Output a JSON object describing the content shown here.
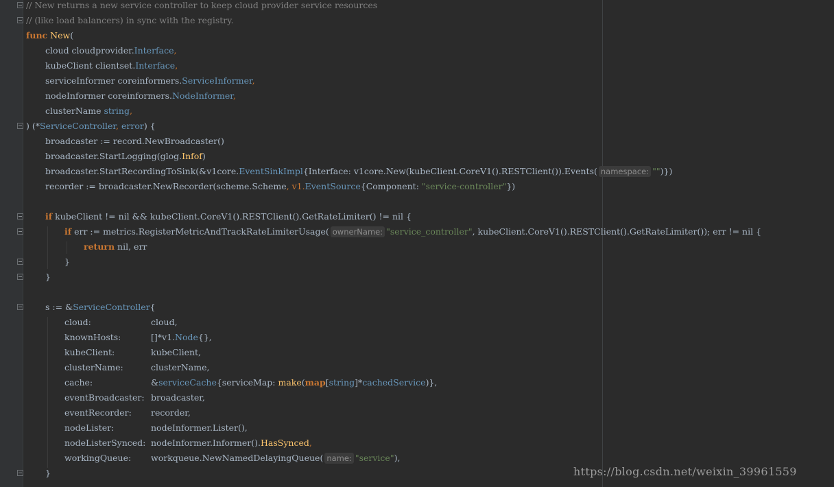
{
  "editor": {
    "theme": "darcula",
    "colors": {
      "background": "#2b2b2b",
      "keyword": "#cc7832",
      "function": "#ffc66d",
      "type": "#6897bb",
      "string": "#6a8759",
      "comment": "#808080",
      "text": "#a9b7c6"
    },
    "lines": {
      "l1": "// New returns a new service controller to keep cloud provider service resources",
      "l2": "// (like load balancers) in sync with the registry.",
      "l3_kw": "func",
      "l3_fn": "New",
      "l3_rest": "(",
      "l4_a": "cloud cloudprovider.",
      "l4_t": "Interface",
      "l5_a": "kubeClient clientset.",
      "l5_t": "Interface",
      "l6_a": "serviceInformer coreinformers.",
      "l6_t": "ServiceInformer",
      "l7_a": "nodeInformer coreinformers.",
      "l7_t": "NodeInformer",
      "l8_a": "clusterName ",
      "l8_t": "string",
      "l9_a": ") (*",
      "l9_t": "ServiceController",
      "l9_b": ", ",
      "l9_t2": "error",
      "l9_c": ") {",
      "l10": "broadcaster := record.NewBroadcaster()",
      "l11_a": "broadcaster.StartLogging(glog.",
      "l11_f": "Infof",
      "l11_b": ")",
      "l12_a": "broadcaster.StartRecordingToSink(&v1core.",
      "l12_t": "EventSinkImpl",
      "l12_b": "{Interface: v1core.New(kubeClient.CoreV1().RESTClient()).Events(",
      "l12_hint": "namespace:",
      "l12_s": "\"\"",
      "l12_c": ")})",
      "l13_a": "recorder := broadcaster.NewRecorder(scheme.Scheme",
      "l13_b": ", v1.",
      "l13_t": "EventSource",
      "l13_c": "{Component: ",
      "l13_s": "\"service-controller\"",
      "l13_d": "})",
      "l15_kw": "if",
      "l15_rest": " kubeClient != nil && kubeClient.CoreV1().RESTClient().GetRateLimiter() != nil {",
      "l16_kw": "if",
      "l16_a": " err := metrics.RegisterMetricAndTrackRateLimiterUsage(",
      "l16_hint": "ownerName:",
      "l16_s": "\"service_controller\"",
      "l16_b": ", kubeClient.CoreV1().RESTClient().GetRateLimiter())",
      "l16_c": "; err != nil {",
      "l17_kw": "return",
      "l17_rest": " nil, err",
      "l18": "}",
      "l19": "}",
      "l21_a": "s := &",
      "l21_t": "ServiceController",
      "l21_b": "{",
      "f_cloud_k": "cloud:",
      "f_cloud_v": "cloud,",
      "f_known_k": "knownHosts:",
      "f_known_v1": "[]*v1.",
      "f_known_t": "Node",
      "f_known_v2": "{},",
      "f_kube_k": "kubeClient:",
      "f_kube_v": "kubeClient,",
      "f_cluster_k": "clusterName:",
      "f_cluster_v": "clusterName,",
      "f_cache_k": "cache:",
      "f_cache_v1": "&",
      "f_cache_t": "serviceCache",
      "f_cache_v2": "{serviceMap: ",
      "f_cache_f": "make",
      "f_cache_v3": "(",
      "f_cache_kw": "map",
      "f_cache_v4": "[",
      "f_cache_t2": "string",
      "f_cache_v5": "]*",
      "f_cache_t3": "cachedService",
      "f_cache_v6": ")},",
      "f_eb_k": "eventBroadcaster:",
      "f_eb_v": "broadcaster,",
      "f_er_k": "eventRecorder:",
      "f_er_v": "recorder,",
      "f_nl_k": "nodeLister:",
      "f_nl_v": "nodeInformer.Lister(),",
      "f_nls_k": "nodeListerSynced:",
      "f_nls_v1": "nodeInformer.Informer().",
      "f_nls_f": "HasSynced",
      "f_nls_v2": ",",
      "f_wq_k": "workingQueue:",
      "f_wq_v1": "workqueue.NewNamedDelayingQueue(",
      "f_wq_hint": "name:",
      "f_wq_s": "\"service\"",
      "f_wq_v2": "),",
      "l32": "}"
    }
  },
  "watermark": "https://blog.csdn.net/weixin_39961559"
}
